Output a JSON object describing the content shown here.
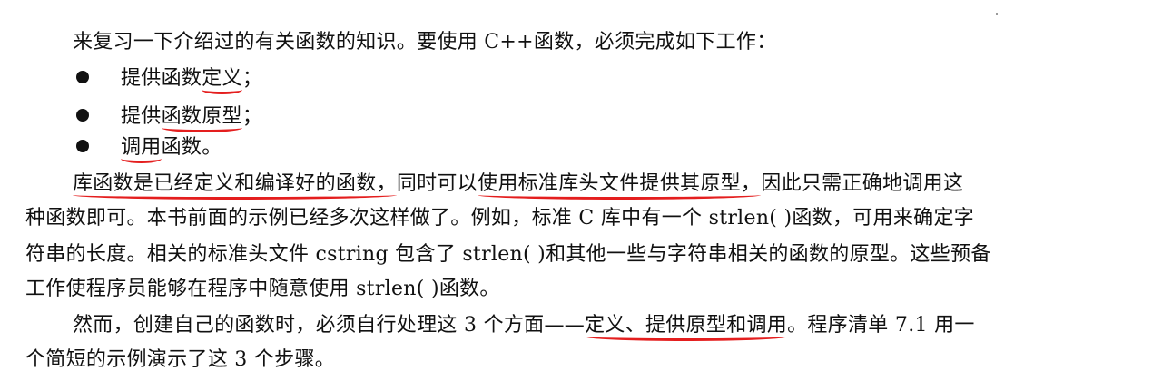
{
  "intro": "来复习一下介绍过的有关函数的知识。要使用 C++函数，必须完成如下工作：",
  "bullets": [
    {
      "before": "提供函数",
      "underlined": "定义",
      "after": "；"
    },
    {
      "before": "提供",
      "underlined": "函数原型",
      "after": "；"
    },
    {
      "before": "",
      "underlined": "调用",
      "after": "函数。"
    }
  ],
  "paragraph1": {
    "line1": {
      "u1": "库函数是已经定义和编译好的函数，",
      "mid": "同时可以",
      "u2": "使用标准库头文件提供其原型，",
      "end": "因此只需正确地调用这"
    },
    "line2": "种函数即可。本书前面的示例已经多次这样做了。例如，标准 C 库中有一个 strlen( )函数，可用来确定字",
    "line3": "符串的长度。相关的标准头文件 cstring 包含了 strlen( )和其他一些与字符串相关的函数的原型。这些预备",
    "line4": "工作使程序员能够在程序中随意使用 strlen( )函数。"
  },
  "paragraph2": {
    "line1": {
      "before": "然而，创建自己的函数时，必须自行处理这 3 个方面——",
      "underlined": "定义、提供原型和调用",
      "after": "。程序清单 7.1 用一"
    },
    "line2": "个简短的示例演示了这 3 个步骤。"
  },
  "colors": {
    "text": "#111111",
    "underline": "#e41e1e"
  }
}
